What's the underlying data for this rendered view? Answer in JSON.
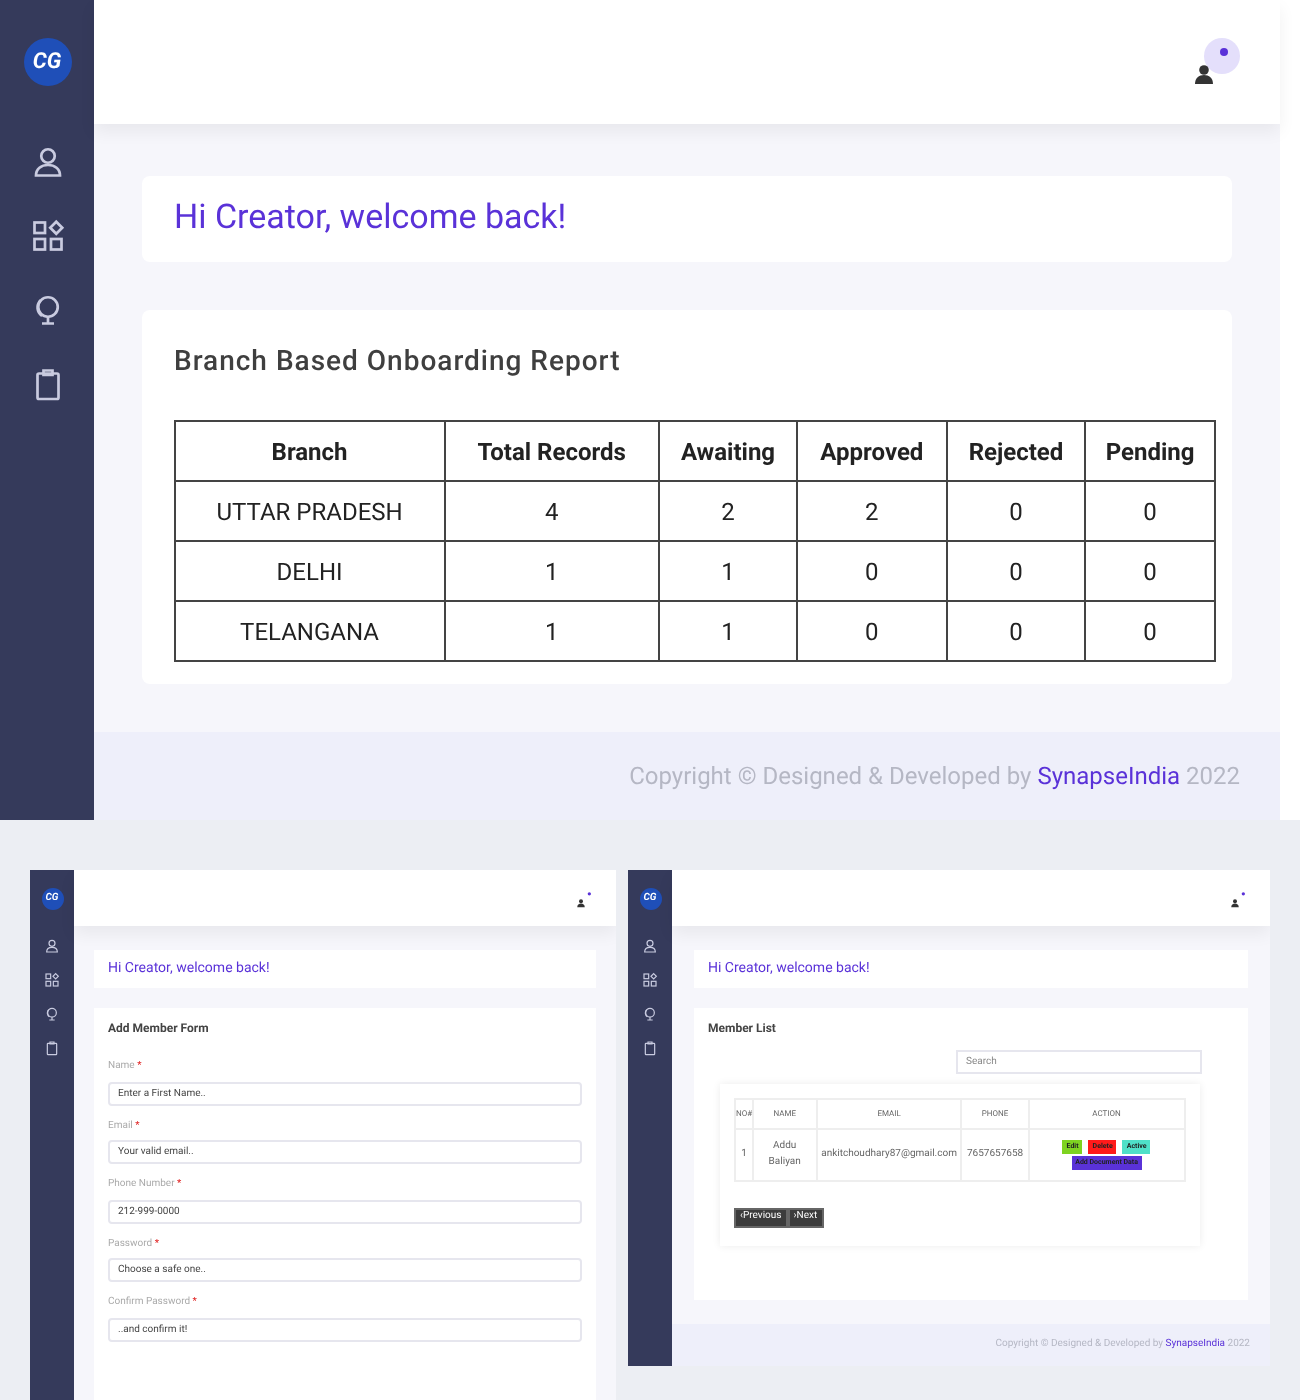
{
  "report_screen": {
    "logo_text": "CG",
    "greeting": "Hi Creator, welcome back!",
    "report": {
      "title": "Branch Based Onboarding Report",
      "columns": [
        "Branch",
        "Total Records",
        "Awaiting",
        "Approved",
        "Rejected",
        "Pending"
      ],
      "rows": [
        [
          "UTTAR PRADESH",
          "4",
          "2",
          "2",
          "0",
          "0"
        ],
        [
          "DELHI",
          "1",
          "1",
          "0",
          "0",
          "0"
        ],
        [
          "TELANGANA",
          "1",
          "1",
          "0",
          "0",
          "0"
        ]
      ]
    },
    "footer": {
      "text": "Copyright © Designed & Developed by",
      "link": "SynapseIndia",
      "year": "2022"
    }
  },
  "form_screen": {
    "logo_text": "CG",
    "greeting": "Hi Creator, welcome back!",
    "form": {
      "title": "Add Member Form",
      "fields": [
        {
          "label": "Name",
          "required_mark": "*",
          "placeholder": "Enter a First Name.."
        },
        {
          "label": "Email",
          "required_mark": "*",
          "placeholder": "Your valid email.."
        },
        {
          "label": "Phone Number",
          "required_mark": "*",
          "placeholder": "212-999-0000"
        },
        {
          "label": "Password",
          "required_mark": "*",
          "placeholder": "Choose a safe one.."
        },
        {
          "label": "Confirm Password",
          "required_mark": "*",
          "placeholder": "..and confirm it!"
        }
      ]
    }
  },
  "list_screen": {
    "logo_text": "CG",
    "greeting": "Hi Creator, welcome back!",
    "list": {
      "title": "Member List",
      "search": {
        "placeholder": "Search"
      },
      "columns": [
        "NO#",
        "NAME",
        "EMAIL",
        "PHONE",
        "ACTION"
      ],
      "rows": [
        {
          "cells": [
            "1",
            "Addu Baliyan",
            "ankitchoudhary87@gmail.com",
            "7657657658"
          ],
          "actions": [
            {
              "label": "Edit",
              "color": "#7ed321"
            },
            {
              "label": "Delete",
              "color": "#ff1a1a"
            },
            {
              "label": "Active",
              "color": "#4fe0c8"
            },
            {
              "label": "Add Document Data",
              "color": "#5a32d8"
            }
          ]
        }
      ],
      "pagination": [
        "‹Previous",
        "›Next"
      ]
    },
    "footer": {
      "text": "Copyright © Designed & Developed by",
      "link": "SynapseIndia",
      "year": "2022"
    }
  }
}
